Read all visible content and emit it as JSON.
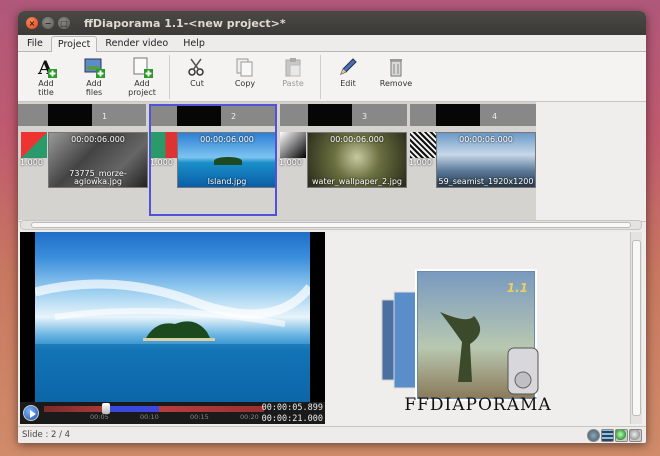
{
  "window": {
    "title": "ffDiaporama 1.1-<new project>*"
  },
  "menu": {
    "tabs": [
      {
        "label": "File"
      },
      {
        "label": "Project"
      },
      {
        "label": "Render video"
      },
      {
        "label": "Help"
      }
    ]
  },
  "toolbar": {
    "add_title": "Add\ntitle",
    "add_files": "Add\nfiles",
    "add_project": "Add\nproject",
    "cut": "Cut",
    "copy": "Copy",
    "paste": "Paste",
    "edit": "Edit",
    "remove": "Remove"
  },
  "timeline": {
    "slides": [
      {
        "number": "1",
        "duration": "00:00:06.000",
        "filename": "73775_morze-\naglowka.jpg",
        "transition_duration": "1.000"
      },
      {
        "number": "2",
        "duration": "00:00:06.000",
        "filename": "Island.jpg",
        "transition_duration": "1.000"
      },
      {
        "number": "3",
        "duration": "00:00:06.000",
        "filename": "water_wallpaper_2.jpg",
        "transition_duration": "1.000"
      },
      {
        "number": "4",
        "duration": "00:00:06.000",
        "filename": "59_seamist_1920x1200",
        "transition_duration": "1.000"
      }
    ]
  },
  "player": {
    "current_time": "00:00:05.899",
    "total_time": "00:00:21.000",
    "ticks": [
      "00:05",
      "00:10",
      "00:15",
      "00:20"
    ],
    "progress_fraction": 0.28
  },
  "logo": {
    "text": "FFDIAPORAMA",
    "version": "1.1"
  },
  "status": {
    "slide": "Slide : 2 / 4"
  }
}
